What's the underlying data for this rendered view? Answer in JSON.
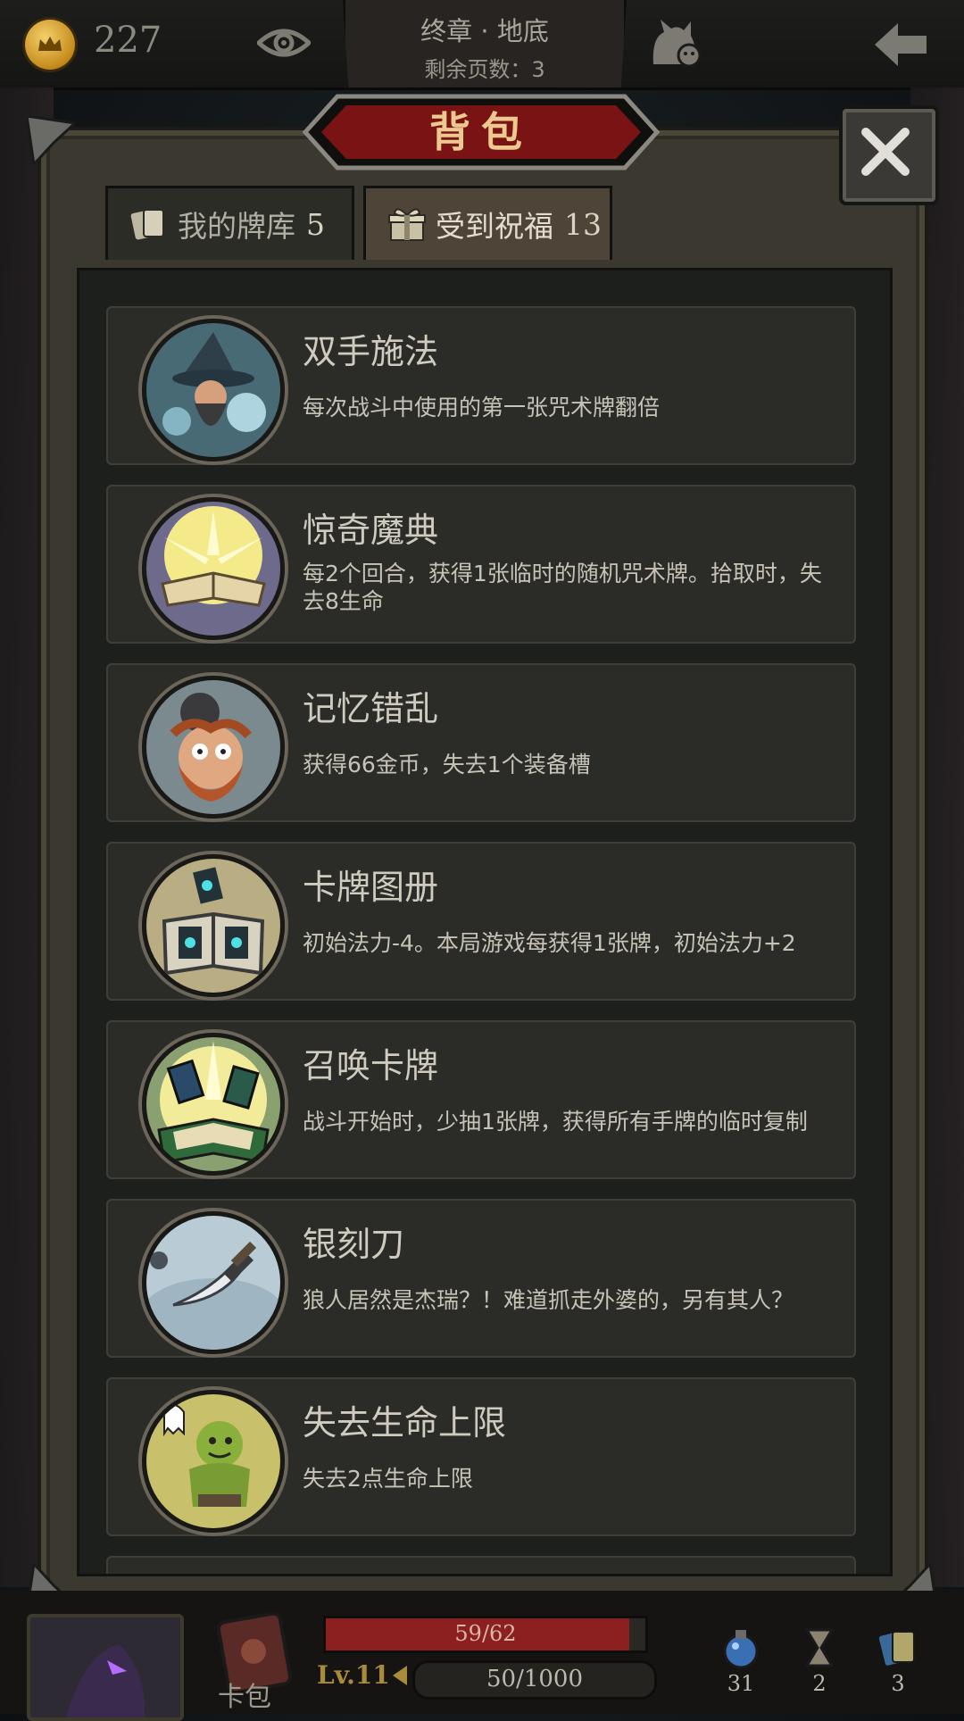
{
  "hud": {
    "gold": "227",
    "chapter": "终章 · 地底",
    "pages_left": "剩余页数：3"
  },
  "panel": {
    "title": "背包",
    "tabs": [
      {
        "label": "我的牌库",
        "count": "5",
        "icon": "cards-icon"
      },
      {
        "label": "受到祝福",
        "count": "13",
        "icon": "gift-icon"
      }
    ],
    "active_tab": 1
  },
  "blessings": [
    {
      "name": "双手施法",
      "desc": "每次战斗中使用的第一张咒术牌翻倍",
      "icon": "wizard-icon"
    },
    {
      "name": "惊奇魔典",
      "desc": "每2个回合，获得1张临时的随机咒术牌。拾取时，失去8生命",
      "icon": "spellbook-icon"
    },
    {
      "name": "记忆错乱",
      "desc": "获得66金币，失去1个装备槽",
      "icon": "confused-man-icon"
    },
    {
      "name": "卡牌图册",
      "desc": "初始法力-4。本局游戏每获得1张牌，初始法力+2",
      "icon": "card-album-icon"
    },
    {
      "name": "召唤卡牌",
      "desc": "战斗开始时，少抽1张牌，获得所有手牌的临时复制",
      "icon": "summon-cards-icon"
    },
    {
      "name": "银刻刀",
      "desc": "狼人居然是杰瑞？！难道抓走外婆的，另有其人？",
      "icon": "silver-knife-icon"
    },
    {
      "name": "失去生命上限",
      "desc": "失去2点生命上限",
      "icon": "goblin-icon"
    }
  ],
  "bottom": {
    "card_pack_label": "卡包",
    "hp_text": "59/62",
    "hp_fraction": 0.95,
    "level": "Lv.11",
    "xp_text": "50/1000",
    "stats": [
      "31",
      "2",
      "3"
    ]
  },
  "colors": {
    "title_plate": "#7a1414",
    "title_text": "#ecc98e",
    "hp_fill": "#8c2020",
    "level_gold": "#a98b3a"
  }
}
